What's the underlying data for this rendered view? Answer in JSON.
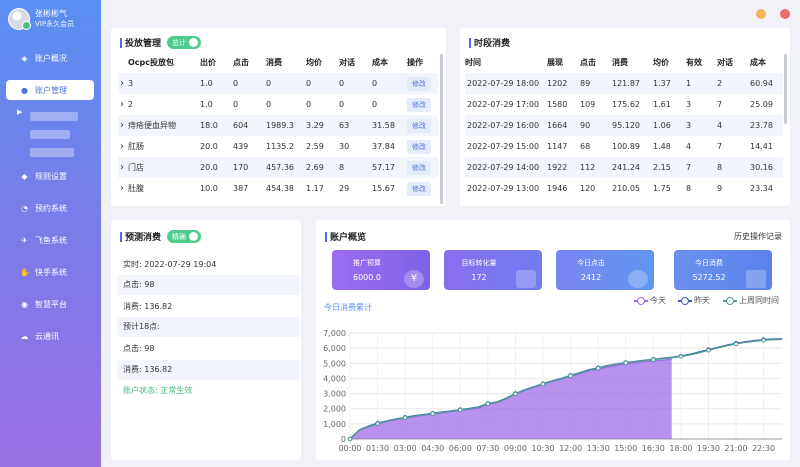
{
  "user": {
    "name": "张彬彬气",
    "level": "VIP永久会员"
  },
  "sidebar": {
    "items": [
      {
        "label": "账户概况",
        "icon": "cube-icon"
      },
      {
        "label": "账户管理",
        "icon": "user-icon"
      },
      {
        "label": "规则设置",
        "icon": "layers-icon"
      },
      {
        "label": "预约系统",
        "icon": "clock-icon"
      },
      {
        "label": "飞鱼系统",
        "icon": "plane-icon"
      },
      {
        "label": "快手系统",
        "icon": "hand-icon"
      },
      {
        "label": "智慧平台",
        "icon": "chat-icon"
      },
      {
        "label": "云通讯",
        "icon": "cloud-icon"
      }
    ]
  },
  "window": {
    "minimize_color": "#f5b65b",
    "close_color": "#f06b6b"
  },
  "ads": {
    "title": "投放管理",
    "toggle_label": "总计",
    "columns": [
      "Ocpc投放包",
      "出价",
      "点击",
      "消费",
      "均价",
      "对话",
      "成本",
      "操作"
    ],
    "rows": [
      [
        "3",
        "1.0",
        "0",
        "0",
        "0",
        "0",
        "0",
        "修改"
      ],
      [
        "2",
        "1.0",
        "0",
        "0",
        "0",
        "0",
        "0",
        "修改"
      ],
      [
        "痔疮便血异物",
        "18.0",
        "604",
        "1989.3",
        "3.29",
        "63",
        "31.58",
        "修改"
      ],
      [
        "肛肠",
        "20.0",
        "439",
        "1135.2",
        "2.59",
        "30",
        "37.84",
        "修改"
      ],
      [
        "门店",
        "20.0",
        "170",
        "457.36",
        "2.69",
        "8",
        "57.17",
        "修改"
      ],
      [
        "肚腹",
        "10.0",
        "387",
        "454.38",
        "1.17",
        "29",
        "15.67",
        "修改"
      ]
    ]
  },
  "timeslot": {
    "title": "时段消费",
    "columns": [
      "时间",
      "展现",
      "点击",
      "消费",
      "均价",
      "有效",
      "对话",
      "成本"
    ],
    "rows": [
      [
        "2022-07-29 18:00",
        "1202",
        "89",
        "121.87",
        "1.37",
        "1",
        "2",
        "60.94"
      ],
      [
        "2022-07-29 17:00",
        "1580",
        "109",
        "175.62",
        "1.61",
        "3",
        "7",
        "25.09"
      ],
      [
        "2022-07-29 16:00",
        "1664",
        "90",
        "95.120",
        "1.06",
        "3",
        "4",
        "23.78"
      ],
      [
        "2022-07-29 15:00",
        "1147",
        "68",
        "100.89",
        "1.48",
        "4",
        "7",
        "14.41"
      ],
      [
        "2022-07-29 14:00",
        "1922",
        "112",
        "241.24",
        "2.15",
        "7",
        "8",
        "30.16"
      ],
      [
        "2022-07-29 13:00",
        "1946",
        "120",
        "210.05",
        "1.75",
        "8",
        "9",
        "23.34"
      ]
    ]
  },
  "forecast": {
    "title": "预测消费",
    "toggle_label": "精确",
    "rows": [
      "实时:  2022-07-29 19:04",
      "点击:  98",
      "消费:  136.82",
      "预计18点:",
      "点击:  98",
      "消费:  136.82"
    ],
    "status": "账户状态:  正常生效",
    "status_color": "#43b97a"
  },
  "overview": {
    "title": "账户概览",
    "history_link": "历史操作记录",
    "cards": [
      {
        "title": "推广预算",
        "value": "6000.0",
        "icon": "yen-icon",
        "color_from": "#9c6cf0",
        "color_to": "#7d63e8"
      },
      {
        "title": "目标转化量",
        "value": "172",
        "icon": "wallet-icon",
        "color_from": "#8b6ef0",
        "color_to": "#6f7cf0"
      },
      {
        "title": "今日点击",
        "value": "2412",
        "icon": "clock-icon",
        "color_from": "#7b86f2",
        "color_to": "#5f96f0"
      },
      {
        "title": "今日消费",
        "value": "5272.52",
        "icon": "grid-icon",
        "color_from": "#6a90f0",
        "color_to": "#5a82ea"
      }
    ],
    "chart_label": "今日消费累计"
  },
  "chart_data": {
    "type": "line",
    "x": [
      "00:00",
      "00:30",
      "01:00",
      "01:30",
      "02:00",
      "02:30",
      "03:00",
      "03:30",
      "04:00",
      "04:30",
      "05:00",
      "05:30",
      "06:00",
      "06:30",
      "07:00",
      "07:30",
      "08:00",
      "08:30",
      "09:00",
      "09:30",
      "10:00",
      "10:30",
      "11:00",
      "11:30",
      "12:00",
      "12:30",
      "13:00",
      "13:30",
      "14:00",
      "14:30",
      "15:00",
      "15:30",
      "16:00",
      "16:30",
      "17:00",
      "17:30",
      "18:00",
      "18:30",
      "19:00",
      "19:30",
      "20:00",
      "20:30",
      "21:00",
      "21:30",
      "22:00",
      "22:30",
      "23:00",
      "23:30"
    ],
    "xticks": [
      "00:00",
      "01:30",
      "03:00",
      "04:30",
      "06:00",
      "07:30",
      "09:00",
      "10:30",
      "12:00",
      "13:30",
      "15:00",
      "16:30",
      "18:00",
      "19:30",
      "21:00",
      "22:30"
    ],
    "yticks": [
      0,
      1000,
      2000,
      3000,
      4000,
      5000,
      6000,
      7000
    ],
    "ylim": [
      0,
      7000
    ],
    "grid": true,
    "legend_position": "top-right",
    "series": [
      {
        "name": "今天",
        "color": "#9f6de8",
        "area": true,
        "values": [
          0,
          550,
          800,
          1000,
          1150,
          1280,
          1380,
          1480,
          1570,
          1650,
          1720,
          1800,
          1880,
          1960,
          2050,
          2300,
          2400,
          2650,
          2950,
          3200,
          3400,
          3600,
          3800,
          3950,
          4150,
          4300,
          4500,
          4600,
          4750,
          4850,
          4950,
          5020,
          5100,
          5150,
          5200,
          5272
        ]
      },
      {
        "name": "昨天",
        "color": "#3f5ea8",
        "area": false,
        "values": [
          0,
          600,
          850,
          1050,
          1200,
          1330,
          1430,
          1540,
          1620,
          1700,
          1780,
          1860,
          1940,
          2020,
          2120,
          2350,
          2450,
          2700,
          3000,
          3250,
          3450,
          3650,
          3850,
          4000,
          4200,
          4380,
          4580,
          4700,
          4850,
          4950,
          5050,
          5120,
          5200,
          5260,
          5330,
          5400,
          5480,
          5600,
          5750,
          5900,
          6050,
          6200,
          6320,
          6420,
          6500,
          6560,
          6600,
          6620
        ]
      },
      {
        "name": "上周同时间",
        "color": "#4a9a93",
        "area": false,
        "values": [
          0,
          580,
          820,
          1020,
          1180,
          1310,
          1410,
          1510,
          1600,
          1680,
          1760,
          1840,
          1920,
          2000,
          2100,
          2330,
          2430,
          2680,
          2980,
          3230,
          3430,
          3630,
          3830,
          3980,
          4180,
          4360,
          4560,
          4680,
          4830,
          4930,
          5030,
          5100,
          5180,
          5240,
          5300,
          5370,
          5450,
          5560,
          5700,
          5860,
          6010,
          6160,
          6280,
          6380,
          6460,
          6520,
          6560,
          6580
        ]
      }
    ]
  }
}
